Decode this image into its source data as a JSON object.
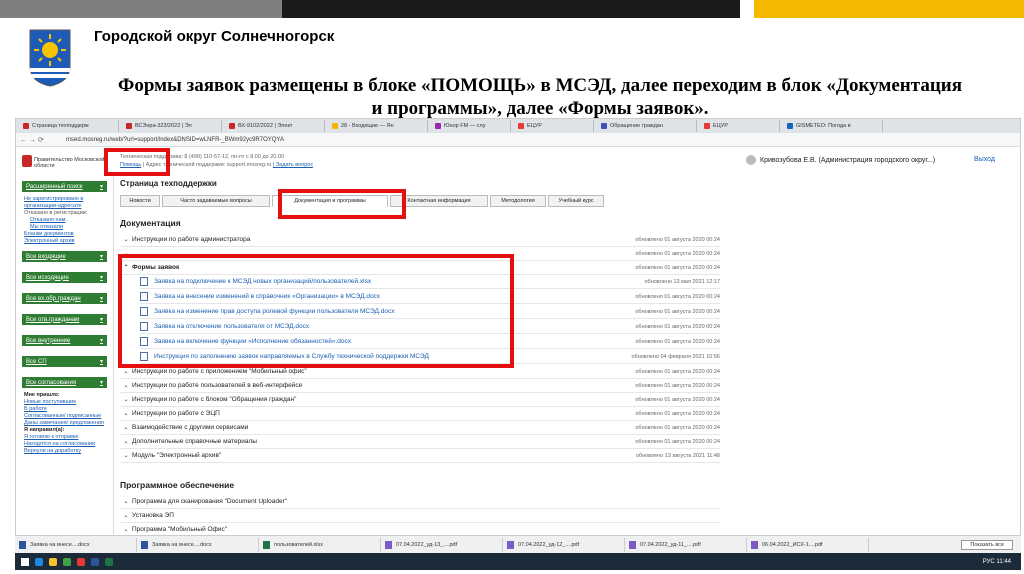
{
  "slide": {
    "org_title": "Городской округ Солнечногорск",
    "heading_line1": "Формы заявок размещены в блоке «ПОМОЩЬ» в МСЭД, далее переходим в блок «Документация",
    "heading_line2": "и программы», далее «Формы заявок»."
  },
  "browser": {
    "tabs": [
      "Страница техподдерж",
      "ВСЭнра-323/2022 | Эл",
      "ВХ-9102/2022 | Элект",
      "28 - Входящие — Ян",
      "Юнор FM — слу",
      "ЕЦУР",
      "Обращение граждан",
      "ЕЦУР",
      "GISMETEO: Погода в"
    ],
    "url": "msed.mosreg.ru/web/?url=support/index&DNSID=wLNFR-_BWm92yc9R7OYQYA"
  },
  "header": {
    "gov_label": "Правительство Московской области",
    "support_phone": "Техническая поддержка: 8 (499) 110-57-12, пн-пт с 8.00 до 20.00",
    "help_link": "Помощь",
    "support_email_text": "| Адрес технической поддержки: support.mosreg.ru",
    "ask_link": "| Задать вопрос",
    "user": "Кривозубова Е.В. (Администрация городского округ...)",
    "exit": "Выход"
  },
  "sidebar": {
    "ext_search": "Расширенный поиск",
    "unregistered": "Не зарегистрировано в организации-адресате",
    "refused_label": "Отказано в регистрации:",
    "refused_us": "Отказано нам",
    "we_refused": "Мы отказали",
    "blanks": "Бланки документов",
    "archive": "Электронный архив",
    "inbound": "Все входящие",
    "outbound": "Все исходящие",
    "citizens_in": "Все вх.обр.граждан",
    "citizens_out": "Все отв.гражданам",
    "internal": "Все внутренние",
    "sp": "Все СП",
    "approvals": "Все согласования",
    "came_label": "Мне пришло:",
    "new": "Новые поступившие",
    "in_work": "В работе",
    "signed": "Согласованные/ подписанные",
    "comments": "Даны замечания/ предложения",
    "sent_label": "Я направил(а):",
    "ready": "Я готовлю к отправке",
    "on_approval": "Находятся на согласовании",
    "returned": "Вернули на доработку"
  },
  "page": {
    "title": "Страница техподдержки",
    "tabs": [
      "Новости",
      "Часто задаваемые вопросы",
      "Документация и программы",
      "Контактная информация",
      "Методология",
      "Учебный курс"
    ],
    "docs_heading": "Документация",
    "docs": [
      {
        "label": "Инструкции по работе администратора",
        "date": "обновлено 01 августа 2020 00:24"
      },
      {
        "label": "",
        "date": "обновлено 01 августа 2020 00:24"
      },
      {
        "label": "",
        "date": "обновлено 01 августа 2020 00:24"
      }
    ],
    "forms_heading": "Формы заявок",
    "forms_date": "обновлено 01 августа 2020 00:24",
    "forms": [
      {
        "label": "Заявка на подключение к МСЭД новых организаций/пользователей.xlsx",
        "date": "обновлено 13 мая 2021 12:17"
      },
      {
        "label": "Заявка на внесение изменений в справочник «Организации» в МСЭД.docx",
        "date": "обновлено 01 августа 2020 00:24"
      },
      {
        "label": "Заявка на изменение прав доступа ролевой функции пользователя МСЭД.docx",
        "date": "обновлено 01 августа 2020 00:24"
      },
      {
        "label": "Заявка на отключение пользователя от МСЭД.docx",
        "date": "обновлено 01 августа 2020 00:24"
      },
      {
        "label": "Заявка на включение функции «Исполнение обязанностей».docx",
        "date": "обновлено 01 августа 2020 00:24"
      },
      {
        "label": "Инструкция по заполнению заявок направляемых в Службу технической поддержки МСЭД",
        "date": "обновлено 04 февраля 2021 10:56"
      }
    ],
    "more_docs": [
      {
        "label": "Инструкции по работе с приложением \"Мобильный офис\"",
        "date": "обновлено 01 августа 2020 00:24"
      },
      {
        "label": "Инструкции по работе пользователей в веб-интерфейсе",
        "date": "обновлено 01 августа 2020 00:24"
      },
      {
        "label": "Инструкции по работе с блоком \"Обращения граждан\"",
        "date": "обновлено 01 августа 2020 00:24"
      },
      {
        "label": "Инструкции по работе с ЭЦП",
        "date": "обновлено 01 августа 2020 00:24"
      },
      {
        "label": "Взаимодействие с другими сервисами",
        "date": "обновлено 01 августа 2020 00:24"
      },
      {
        "label": "Дополнительные справочные материалы",
        "date": "обновлено 01 августа 2020 00:24"
      },
      {
        "label": "Модуль \"Электронный архив\"",
        "date": "обновлено 13 августа 2021 11:48"
      }
    ],
    "software_heading": "Программное обеспечение",
    "software": [
      {
        "label": "Программа для сканирования \"Document Uploader\""
      },
      {
        "label": "Установка ЭП"
      },
      {
        "label": "Программа \"Мобильный Офис\""
      }
    ]
  },
  "taskbar": {
    "items": [
      "Заявка на внесе....docx",
      "Заявка на внесе....docx",
      "пользователей.xlsx",
      "07.04.2022_уд-13_....pdf",
      "07.04.2022_уд-12_....pdf",
      "07.04.2022_уд-11_....pdf",
      "06.04.2022_ИСХ-1....pdf"
    ],
    "show_all": "Показать все",
    "lang": "РУС",
    "time": "11:44"
  },
  "colors": {
    "accent_red": "#e41010",
    "sidebar_green": "#2e7d32",
    "link_blue": "#1a5fb4"
  }
}
